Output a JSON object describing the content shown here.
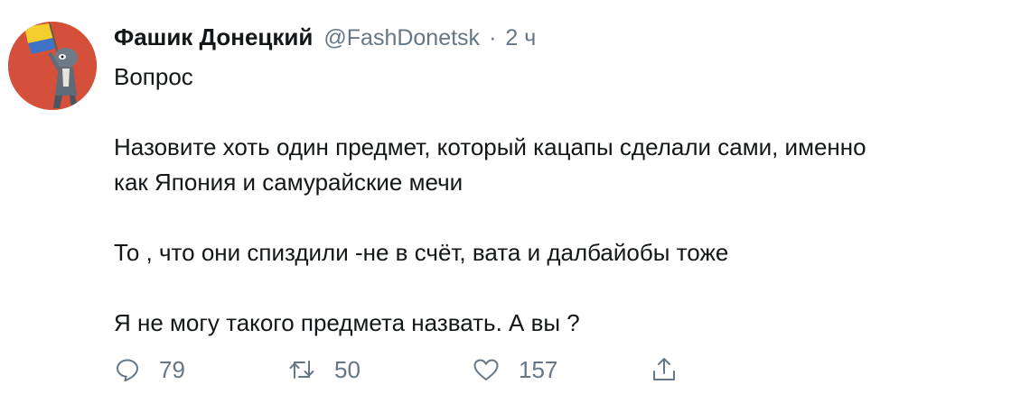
{
  "tweet": {
    "author": {
      "display_name": "Фашик Донецкий",
      "handle": "@FashDonetsk",
      "separator": "·",
      "time": "2 ч"
    },
    "paragraphs": [
      "Вопрос",
      "Назовите хоть один предмет, который кацапы сделали сами, именно\nкак Япония и самурайские мечи",
      "То , что они спиздили -не в счёт, вата и далбайобы тоже",
      "Я не могу такого предмета назвать. А вы ?"
    ],
    "actions": {
      "reply": {
        "icon": "reply-icon",
        "count": "79"
      },
      "retweet": {
        "icon": "retweet-icon",
        "count": "50"
      },
      "like": {
        "icon": "heart-icon",
        "count": "157"
      },
      "share": {
        "icon": "share-icon"
      }
    }
  },
  "colors": {
    "text": "#14171a",
    "secondary": "#657786",
    "background": "#ffffff",
    "avatar_background": "#d4503a"
  }
}
